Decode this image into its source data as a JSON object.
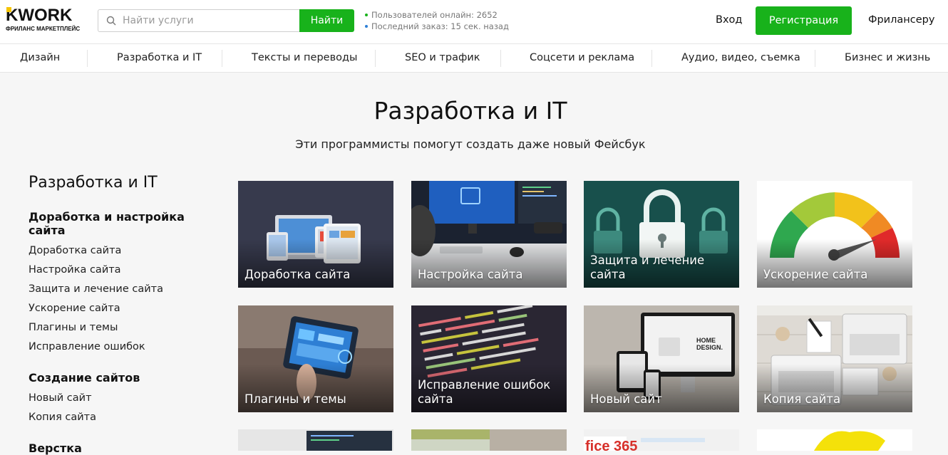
{
  "header": {
    "logo_text": "KWORK",
    "logo_sub": "ФРИЛАНС МАРКЕТПЛЕЙС",
    "search_placeholder": "Найти услуги",
    "search_button": "Найти",
    "stats": [
      {
        "text": "Пользователей онлайн: 2652",
        "color": "#18b21b"
      },
      {
        "text": "Последний заказ: 15 сек. назад",
        "color": "#2d7fd6"
      }
    ],
    "login": "Вход",
    "register": "Регистрация",
    "freelancer": "Фрилансеру"
  },
  "categories": [
    "Дизайн",
    "Разработка и IT",
    "Тексты и переводы",
    "SEO и трафик",
    "Соцсети и реклама",
    "Аудио, видео, съемка",
    "Бизнес и жизнь"
  ],
  "page": {
    "title": "Разработка и IT",
    "subtitle": "Эти программисты помогут создать даже новый Фейсбук"
  },
  "sidebar": {
    "title": "Разработка и IT",
    "groups": [
      {
        "title": "Доработка и настройка сайта",
        "items": [
          "Доработка сайта",
          "Настройка сайта",
          "Защита и лечение сайта",
          "Ускорение сайта",
          "Плагины и темы",
          "Исправление ошибок"
        ]
      },
      {
        "title": "Создание сайтов",
        "items": [
          "Новый сайт",
          "Копия сайта"
        ]
      },
      {
        "title": "Верстка",
        "items": []
      }
    ]
  },
  "cards": [
    "Доработка сайта",
    "Настройка сайта",
    "Защита и лечение сайта",
    "Ускорение сайта",
    "Плагины и темы",
    "Исправление ошибок сайта",
    "Новый сайт",
    "Копия сайта"
  ],
  "colors": {
    "accent": "#18b21b",
    "logo_yellow": "#f5c400"
  }
}
